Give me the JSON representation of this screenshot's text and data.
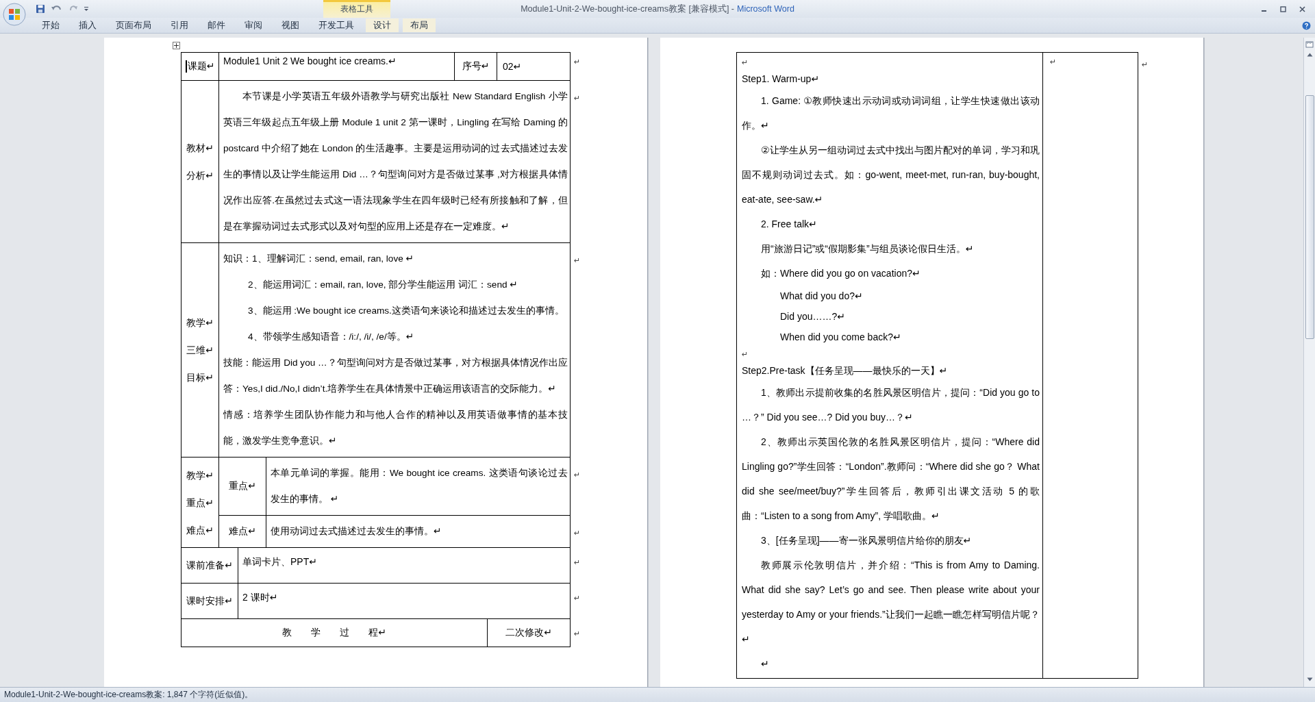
{
  "window": {
    "document_title": "Module1-Unit-2-We-bought-ice-creams教案 [兼容模式] -",
    "app_name": "Microsoft Word",
    "contextual_group": "表格工具"
  },
  "ribbon_tabs": [
    {
      "label": "开始",
      "selected": false,
      "contextual": false
    },
    {
      "label": "插入",
      "selected": false,
      "contextual": false
    },
    {
      "label": "页面布局",
      "selected": false,
      "contextual": false
    },
    {
      "label": "引用",
      "selected": false,
      "contextual": false
    },
    {
      "label": "邮件",
      "selected": false,
      "contextual": false
    },
    {
      "label": "审阅",
      "selected": false,
      "contextual": false
    },
    {
      "label": "视图",
      "selected": false,
      "contextual": false
    },
    {
      "label": "开发工具",
      "selected": false,
      "contextual": false
    },
    {
      "label": "设计",
      "selected": false,
      "contextual": true
    },
    {
      "label": "布局",
      "selected": false,
      "contextual": true
    }
  ],
  "left_table": [
    {
      "kind": "topic",
      "label": [
        "课题↵"
      ],
      "text": "Module1 Unit 2 We bought ice creams.↵",
      "serial_label": "序号↵",
      "serial": "02↵",
      "end_mark": "↵"
    },
    {
      "kind": "paragraphs",
      "label": [
        "教材↵",
        "分析↵"
      ],
      "paragraphs": [
        {
          "kind": "indent",
          "text": "本节课是小学英语五年级外语教学与研究出版社 New Standard English 小学英语三年级起点五年级上册 Module 1 unit 2 第一课时，Lingling 在写给 Daming 的 postcard 中介绍了她在 London 的生活趣事。主要是运用动词的过去式描述过去发生的事情以及让学生能运用 Did …？句型询问对方是否做过某事 ,对方根据具体情况作出应答.在虽然过去式这一语法现象学生在四年级时已经有所接触和了解，但是在掌握动词过去式形式以及对句型的应用上还是存在一定难度。↵"
        }
      ],
      "end_mark": "↵"
    },
    {
      "kind": "paragraphs",
      "label": [
        "教学↵",
        "三维↵",
        "目标↵"
      ],
      "paragraphs": [
        {
          "kind": "plain",
          "text": "知识：1、理解词汇：send, email, ran, love ↵"
        },
        {
          "kind": "item",
          "text": "2、能运用词汇：email, ran, love, 部分学生能运用 词汇：send ↵"
        },
        {
          "kind": "item",
          "text": "3、能运用 :We bought ice creams.这类语句来谈论和描述过去发生的事情。"
        },
        {
          "kind": "item",
          "text": "4、带领学生感知语音：/i:/, /i/, /e/等。↵"
        },
        {
          "kind": "plain",
          "text": "技能：能运用 Did you …？句型询问对方是否做过某事，对方根据具体情况作出应答：Yes,I did./No,I didn’t.培养学生在具体情景中正确运用该语言的交际能力。↵"
        },
        {
          "kind": "plain",
          "text": "情感：培养学生团队协作能力和与他人合作的精神以及用英语做事情的基本技能，激发学生竞争意识。↵"
        }
      ],
      "end_mark": "↵"
    },
    {
      "kind": "focus",
      "label": [
        "教学↵",
        "重点↵",
        "难点↵"
      ],
      "items": [
        {
          "label": "重点↵",
          "text": "本单元单词的掌握。能用：We bought ice creams. 这类语句谈论过去发生的事情。 ↵",
          "end_mark": "↵"
        },
        {
          "label": "难点↵",
          "text": "使用动词过去式描述过去发生的事情。↵",
          "end_mark": "↵"
        }
      ]
    },
    {
      "kind": "simple",
      "label": [
        "课前准备↵"
      ],
      "text": "单词卡片、PPT↵",
      "end_mark": "↵"
    },
    {
      "kind": "simple",
      "label": [
        "课时安排↵"
      ],
      "text": "2 课时↵",
      "end_mark": "↵"
    },
    {
      "kind": "process",
      "text": "教　　学　　过　　程↵",
      "revision": "二次修改↵",
      "end_mark": "↵"
    }
  ],
  "right_table": {
    "content": [
      {
        "kind": "mark",
        "text": "↵"
      },
      {
        "kind": "heading",
        "text": "Step1. Warm-up↵"
      },
      {
        "kind": "indent",
        "text": "1. Game: ①教师快速出示动词或动词词组，让学生快速做出该动作。↵"
      },
      {
        "kind": "indent",
        "text": "②让学生从另一组动词过去式中找出与图片配对的单词，学习和巩固不规则动词过去式。如：go-went, meet-met, run-ran, buy-bought, eat-ate, see-saw.↵"
      },
      {
        "kind": "indent",
        "text": "2. Free talk↵"
      },
      {
        "kind": "indent",
        "text": "用“旅游日记”或“假期影集”与组员谈论假日生活。↵"
      },
      {
        "kind": "indent",
        "text": "如：Where did you go on vacation?↵"
      },
      {
        "kind": "example",
        "text": "What did you do?↵"
      },
      {
        "kind": "example",
        "text": "Did you……?↵"
      },
      {
        "kind": "example",
        "text": "When did you come back?↵"
      },
      {
        "kind": "mark",
        "text": "↵"
      },
      {
        "kind": "heading",
        "text": "Step2.Pre-task【任务呈现——最快乐的一天】↵"
      },
      {
        "kind": "indent",
        "text": "1、教师出示提前收集的名胜风景区明信片，提问：“Did you go to …？” Did you see…? Did you buy…？↵"
      },
      {
        "kind": "indent",
        "text": "2、教师出示英国伦敦的名胜风景区明信片，提问：“Where did Lingling go?”学生回答：“London”.教师问：“Where did she go？ What did she see/meet/buy?”学生回答后，教师引出课文活动 5 的歌曲：“Listen to a song from Amy”, 学唱歌曲。↵"
      },
      {
        "kind": "indent",
        "text": "3、[任务呈现]——寄一张风景明信片给你的朋友↵"
      },
      {
        "kind": "indent",
        "text": "教师展示伦敦明信片，并介绍：“This is from Amy to Daming. What did she say? Let’s go and see. Then please write about your yesterday to Amy or your friends.”让我们一起瞧一瞧怎样写明信片呢？↵"
      },
      {
        "kind": "indent",
        "text": "↵"
      }
    ],
    "revision_mark": "↵",
    "end_mark": "↵"
  },
  "status_bar": "Module1-Unit-2-We-bought-ice-creams教案: 1,847 个字符(近似值)。"
}
